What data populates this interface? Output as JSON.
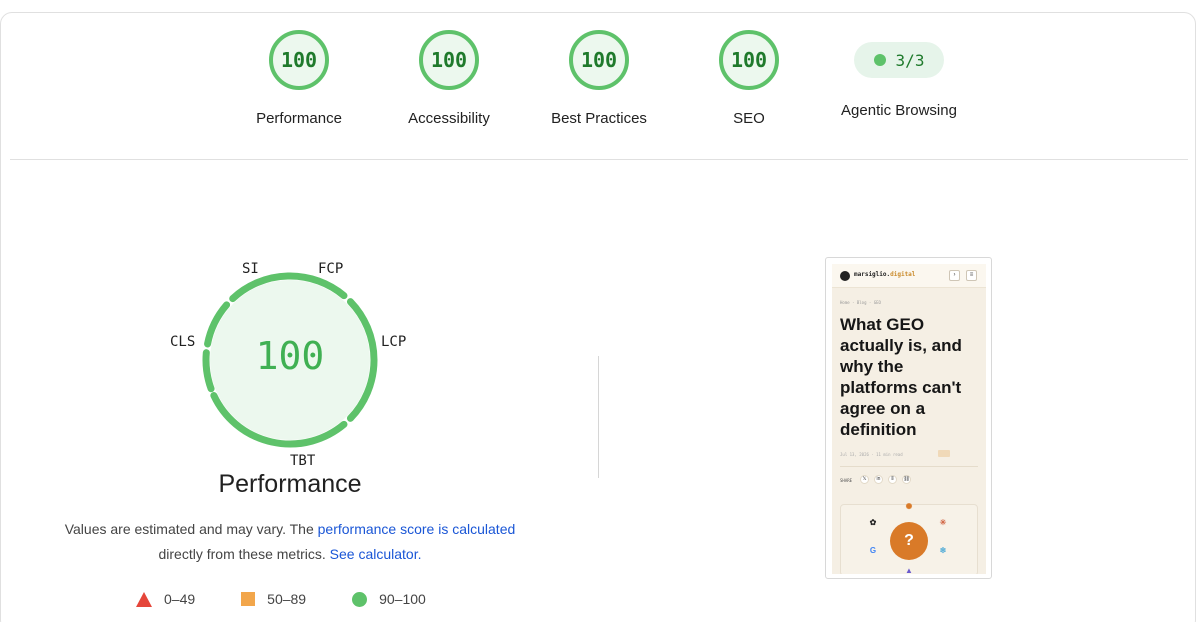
{
  "categories": [
    {
      "score": "100",
      "label": "Performance"
    },
    {
      "score": "100",
      "label": "Accessibility"
    },
    {
      "score": "100",
      "label": "Best Practices"
    },
    {
      "score": "100",
      "label": "SEO"
    }
  ],
  "agentic": {
    "value": "3/3",
    "label": "Agentic Browsing"
  },
  "performance": {
    "score": "100",
    "title": "Performance",
    "metrics": {
      "si": "SI",
      "fcp": "FCP",
      "lcp": "LCP",
      "tbt": "TBT",
      "cls": "CLS"
    },
    "note_prefix": "Values are estimated and may vary. The ",
    "note_link": "performance score is calculated",
    "note_mid": "directly from these metrics. ",
    "calc_link": "See calculator."
  },
  "legend": [
    {
      "range": "0–49",
      "color": "#e5463a"
    },
    {
      "range": "50–89",
      "color": "#f2a64b"
    },
    {
      "range": "90–100",
      "color": "#5ec26a"
    }
  ],
  "colors": {
    "pass": "#5ec26a",
    "pass_text": "#1f7a2c",
    "link": "#1a56d6"
  },
  "screenshot": {
    "brand_main": "marsiglio.",
    "brand_accent": "digital",
    "breadcrumb": "Home · Blog · GEO",
    "headline": "What GEO actually is, and why the platforms can't agree on a definition",
    "meta": "Jul 13, 2026 · 11 min read",
    "share": "SHARE",
    "center_icon": "?"
  }
}
